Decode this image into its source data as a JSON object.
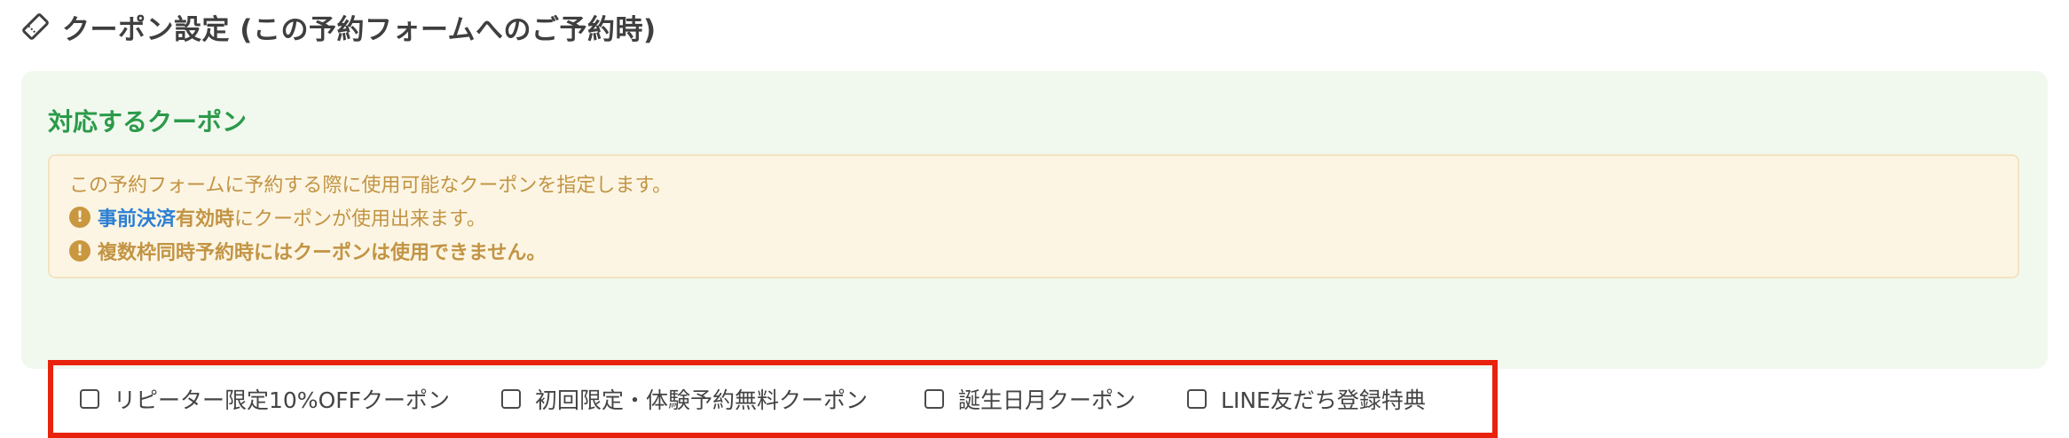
{
  "header": {
    "title": "クーポン設定 (この予約フォームへのご予約時)",
    "icon": "ticket-icon"
  },
  "panel": {
    "section_title": "対応するクーポン",
    "notice": {
      "line1": "この予約フォームに予約する際に使用可能なクーポンを指定します。",
      "line2_link": "事前決済",
      "line2_bold": "有効時",
      "line2_rest": "にクーポンが使用出来ます。",
      "line3": "複数枠同時予約時にはクーポンは使用できません。",
      "warn_glyph": "!"
    },
    "coupons": [
      {
        "label": "リピーター限定10%OFFクーポン",
        "checked": false
      },
      {
        "label": "初回限定・体験予約無料クーポン",
        "checked": false
      },
      {
        "label": "誕生日月クーポン",
        "checked": false
      },
      {
        "label": "LINE友だち登録特典",
        "checked": false
      }
    ]
  },
  "colors": {
    "section_title": "#2c9a4a",
    "panel_bg": "#f1f9ef",
    "notice_bg": "#fcf5e3",
    "notice_text": "#c29444",
    "link": "#2a7fd4",
    "highlight_border": "#e8220d"
  }
}
